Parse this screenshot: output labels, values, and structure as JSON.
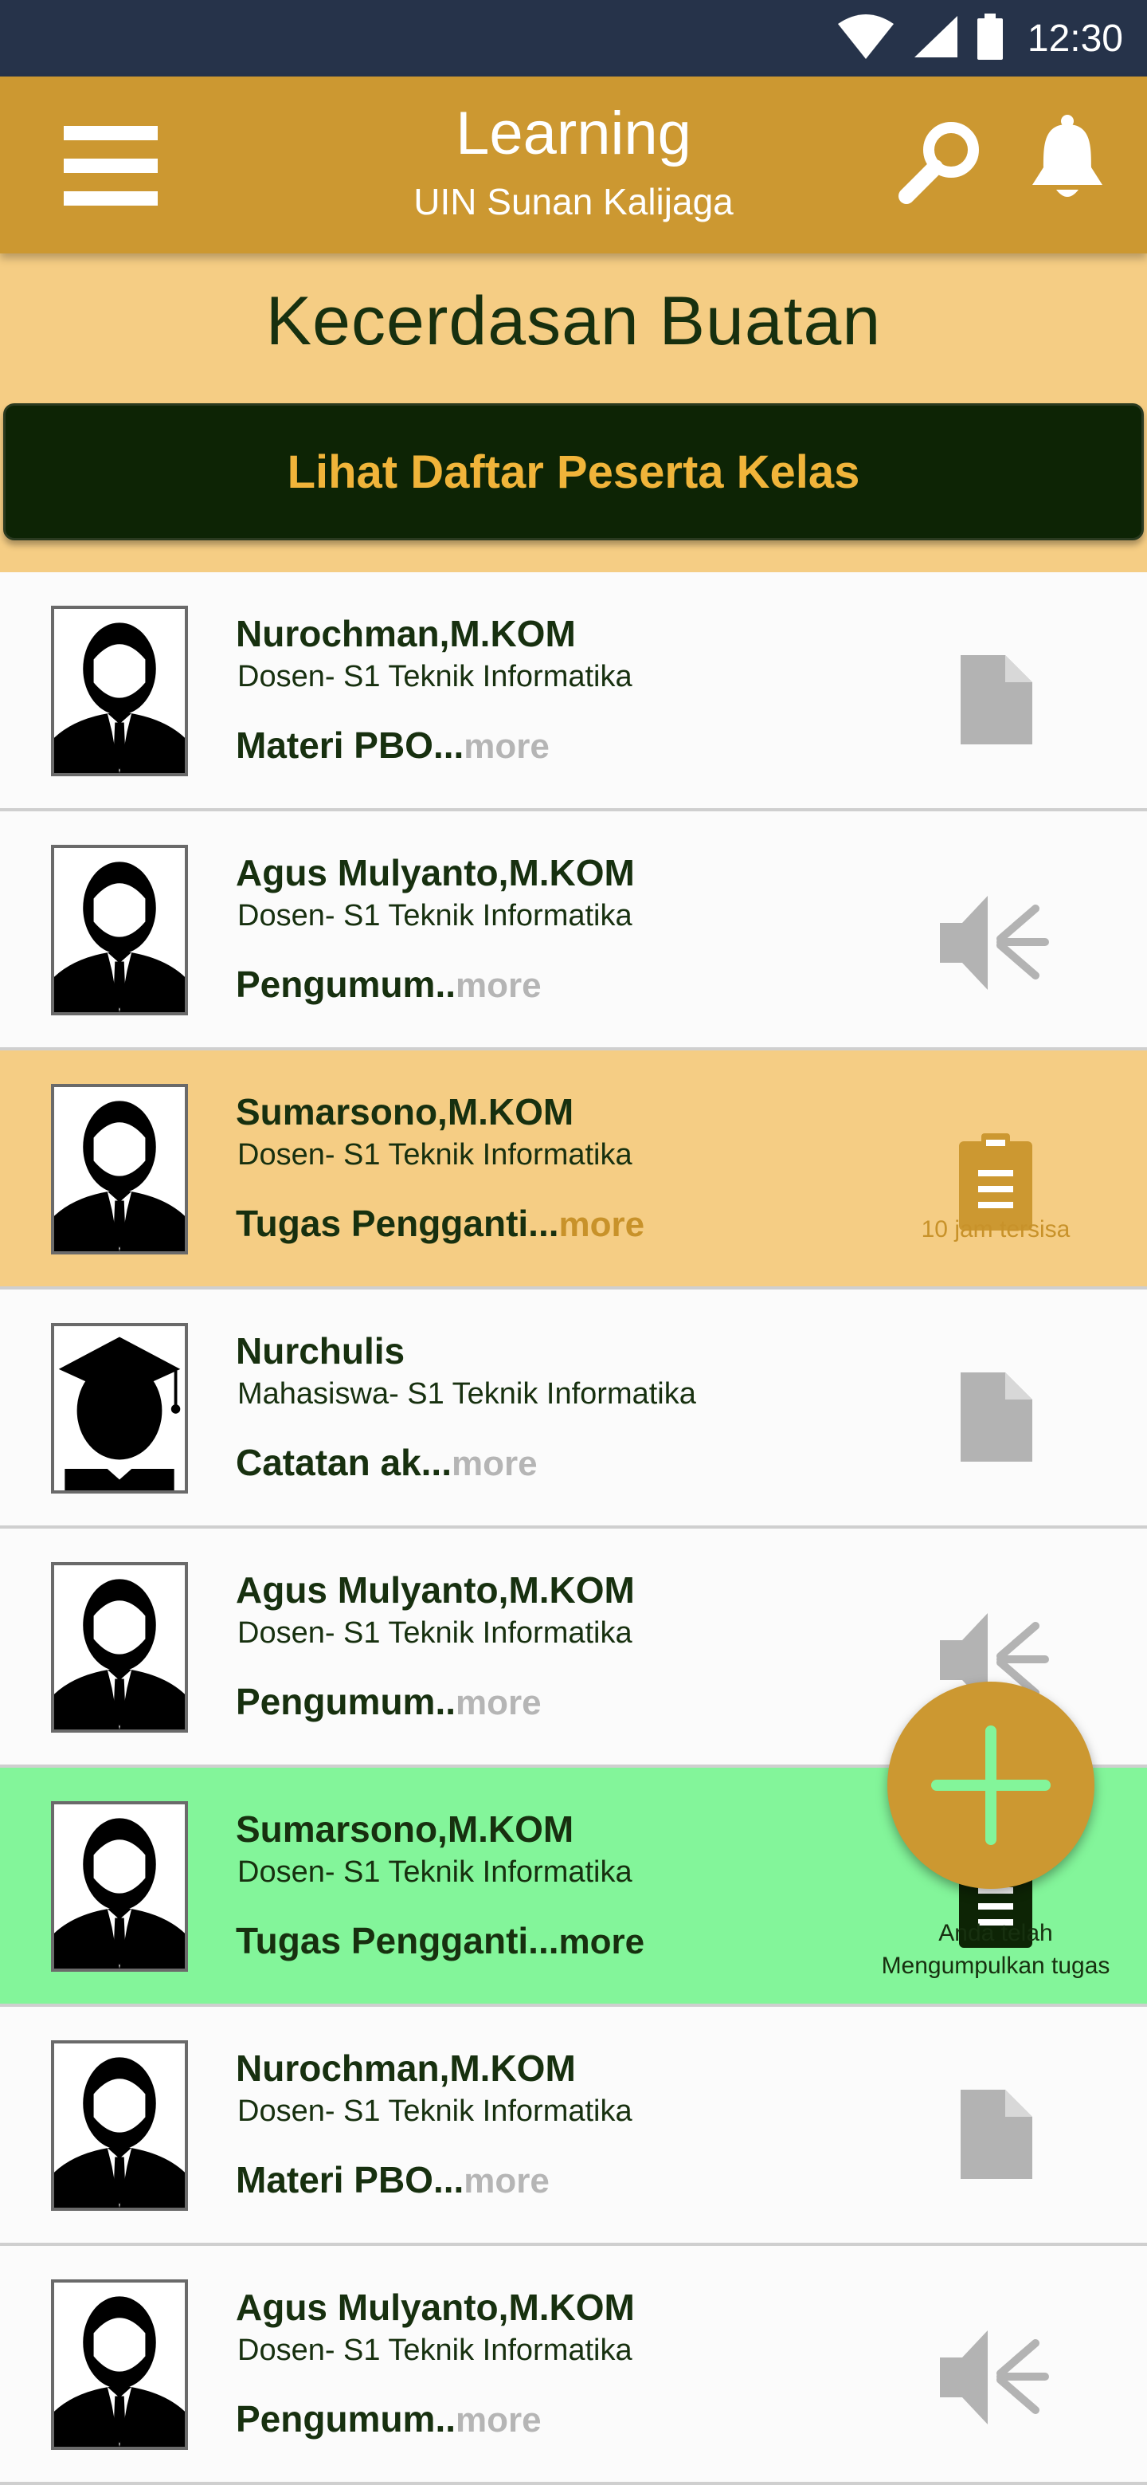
{
  "status_bar": {
    "time": "12:30",
    "icons": [
      "wifi-icon",
      "signal-icon",
      "battery-icon"
    ]
  },
  "app_bar": {
    "title": "Learning",
    "subtitle": "UIN Sunan Kalijaga",
    "icons": [
      "menu-icon",
      "search-icon",
      "bell-icon"
    ]
  },
  "course": {
    "title": "Kecerdasan Buatan",
    "participants_button": "Lihat Daftar Peserta Kelas"
  },
  "feed": [
    {
      "author": "Nurochman,M.KOM",
      "role": "Dosen- S1 Teknik Informatika",
      "excerpt": "Materi PBO...",
      "more": "more",
      "type": "document",
      "state": "normal"
    },
    {
      "author": "Agus Mulyanto,M.KOM",
      "role": "Dosen- S1 Teknik Informatika",
      "excerpt": "Pengumum..",
      "more": "more",
      "type": "announcement",
      "state": "normal"
    },
    {
      "author": "Sumarsono,M.KOM",
      "role": "Dosen- S1 Teknik Informatika",
      "excerpt": "Tugas Pengganti...",
      "more": "more",
      "type": "assignment",
      "state": "deadline",
      "caption": "10 jam tersisa"
    },
    {
      "author": "Nurchulis",
      "role": "Mahasiswa- S1 Teknik Informatika",
      "excerpt": "Catatan ak...",
      "more": "more",
      "type": "document",
      "state": "normal"
    },
    {
      "author": "Agus Mulyanto,M.KOM",
      "role": "Dosen- S1 Teknik Informatika",
      "excerpt": "Pengumum..",
      "more": "more",
      "type": "announcement",
      "state": "normal"
    },
    {
      "author": "Sumarsono,M.KOM",
      "role": "Dosen- S1 Teknik Informatika",
      "excerpt": "Tugas Pengganti...",
      "more": "more",
      "type": "assignment",
      "state": "submitted",
      "caption_line1": "Anda telah",
      "caption_line2": "Mengumpulkan tugas"
    },
    {
      "author": "Nurochman,M.KOM",
      "role": "Dosen- S1 Teknik Informatika",
      "excerpt": "Materi PBO...",
      "more": "more",
      "type": "document",
      "state": "normal"
    },
    {
      "author": "Agus Mulyanto,M.KOM",
      "role": "Dosen- S1 Teknik Informatika",
      "excerpt": "Pengumum..",
      "more": "more",
      "type": "announcement",
      "state": "normal"
    }
  ],
  "colors": {
    "status_bar": "#26334a",
    "app_bar": "#cc9831",
    "header_bg": "#f5cd84",
    "button_bg": "#0d2405",
    "button_text": "#f0b43a",
    "deadline_bg": "#f5cd84",
    "submitted_bg": "#83f59a",
    "icon_gray": "#b3b3b3",
    "text_dark": "#17300f"
  },
  "fab": {
    "icon": "add-icon"
  }
}
